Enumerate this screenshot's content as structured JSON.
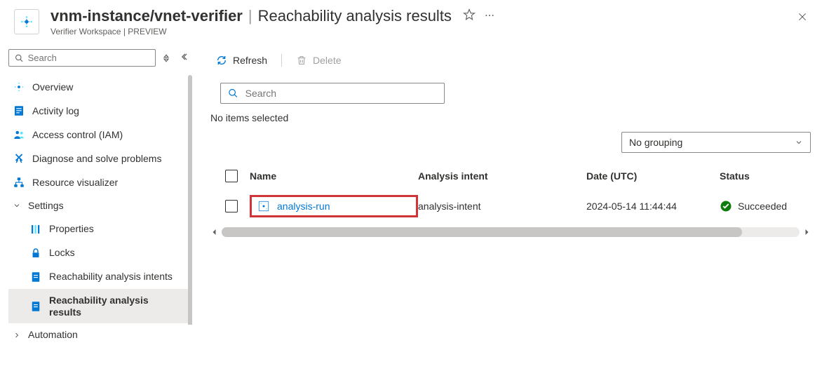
{
  "header": {
    "resource_path": "vnm-instance/vnet-verifier",
    "page_name": "Reachability analysis results",
    "subtitle": "Verifier Workspace | PREVIEW"
  },
  "sidebar": {
    "search_placeholder": "Search",
    "items": {
      "overview": "Overview",
      "activity_log": "Activity log",
      "iam": "Access control (IAM)",
      "diagnose": "Diagnose and solve problems",
      "resource_viz": "Resource visualizer",
      "settings": "Settings",
      "properties": "Properties",
      "locks": "Locks",
      "intents": "Reachability analysis intents",
      "results": "Reachability analysis results",
      "automation": "Automation"
    }
  },
  "toolbar": {
    "refresh": "Refresh",
    "delete": "Delete"
  },
  "main": {
    "search_placeholder": "Search",
    "selection_text": "No items selected",
    "grouping": "No grouping",
    "cols": {
      "name": "Name",
      "intent": "Analysis intent",
      "date": "Date (UTC)",
      "status": "Status"
    },
    "row": {
      "name": "analysis-run",
      "intent": "analysis-intent",
      "date": "2024-05-14 11:44:44",
      "status": "Succeeded"
    }
  }
}
